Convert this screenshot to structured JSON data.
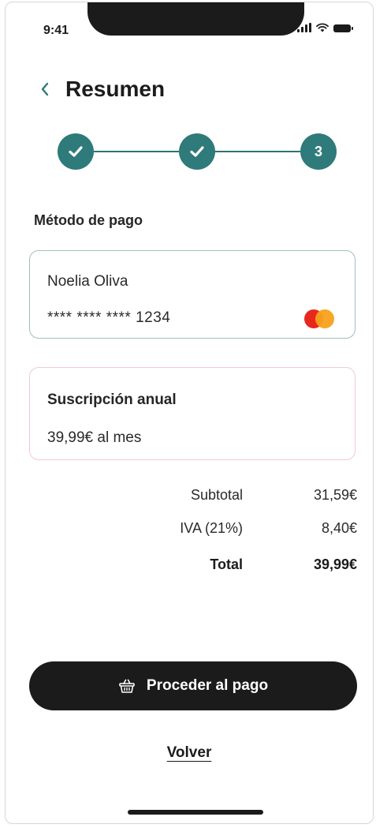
{
  "status_bar": {
    "time": "9:41"
  },
  "header": {
    "title": "Resumen",
    "back_icon": "chevron-left-icon"
  },
  "stepper": {
    "steps": [
      {
        "state": "done",
        "icon": "check-icon"
      },
      {
        "state": "done",
        "icon": "check-icon"
      },
      {
        "state": "current",
        "label": "3"
      }
    ]
  },
  "payment": {
    "section_label": "Método de pago",
    "card_holder": "Noelia Oliva",
    "card_number": "**** **** **** 1234",
    "brand_icon": "mastercard-icon"
  },
  "subscription": {
    "title": "Suscripción anual",
    "price": "39,99€ al mes"
  },
  "summary": {
    "rows": [
      {
        "label": "Subtotal",
        "value": "31,59€"
      },
      {
        "label": "IVA (21%)",
        "value": "8,40€"
      },
      {
        "label": "Total",
        "value": "39,99€"
      }
    ]
  },
  "actions": {
    "pay_label": "Proceder al pago",
    "pay_icon": "basket-icon",
    "back_label": "Volver"
  },
  "colors": {
    "accent": "#2f7a7a",
    "primary_button": "#1b1b1b",
    "card_border": "#9fc0c0",
    "subscription_border": "#f1c9cf"
  }
}
